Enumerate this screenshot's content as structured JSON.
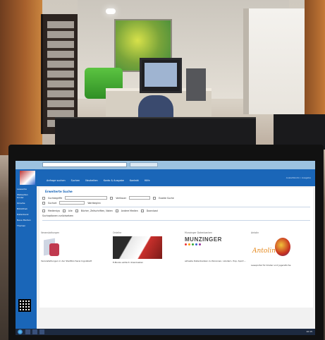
{
  "header": {
    "nav": [
      "Anfrage suchen",
      "Suchen",
      "Neuheiten",
      "Konto & Ausgabe",
      "Kontakt",
      "Hilfe"
    ],
    "right_text": "Ausleihkonto / Ausgabe"
  },
  "sidebar": {
    "items": [
      "Leseecke",
      "Webseiten Kinder",
      "Onleihe",
      "Bibliothek",
      "Datenbank",
      "Neue Medien",
      "Themen"
    ]
  },
  "search": {
    "title": "Erweiterte Suche",
    "row1_label": "Suchbegriffe",
    "row1_option": "Verfasser",
    "row1_right": "Exakte Suche",
    "row2_label": "Suchart",
    "row2_value": "Wortbeginn",
    "row3_items": [
      "Medientyp",
      "Alle",
      "Bücher, Zeitschriften, Noten",
      "Andere Medien",
      "Download"
    ],
    "row4_text": "Suchoptionen zurücksetzen"
  },
  "columns": [
    {
      "title": "Veranstaltungen",
      "text": "Veranstaltungen in der Stadtbücherei Ingolstadt"
    },
    {
      "title": "Onleihe",
      "text": "E-Books einfach downloaden"
    },
    {
      "title": "Munzinger Datenbanken",
      "text": "aktuelle Datenbanken zu Personen, Ländern, Pop, Sport..."
    },
    {
      "title": "Antolin",
      "text": "Leseportal für Kinder und Jugendliche"
    }
  ],
  "munzinger_logo": "MUNZINGER",
  "antolin_logo": "Antolin",
  "clock": "10:15"
}
